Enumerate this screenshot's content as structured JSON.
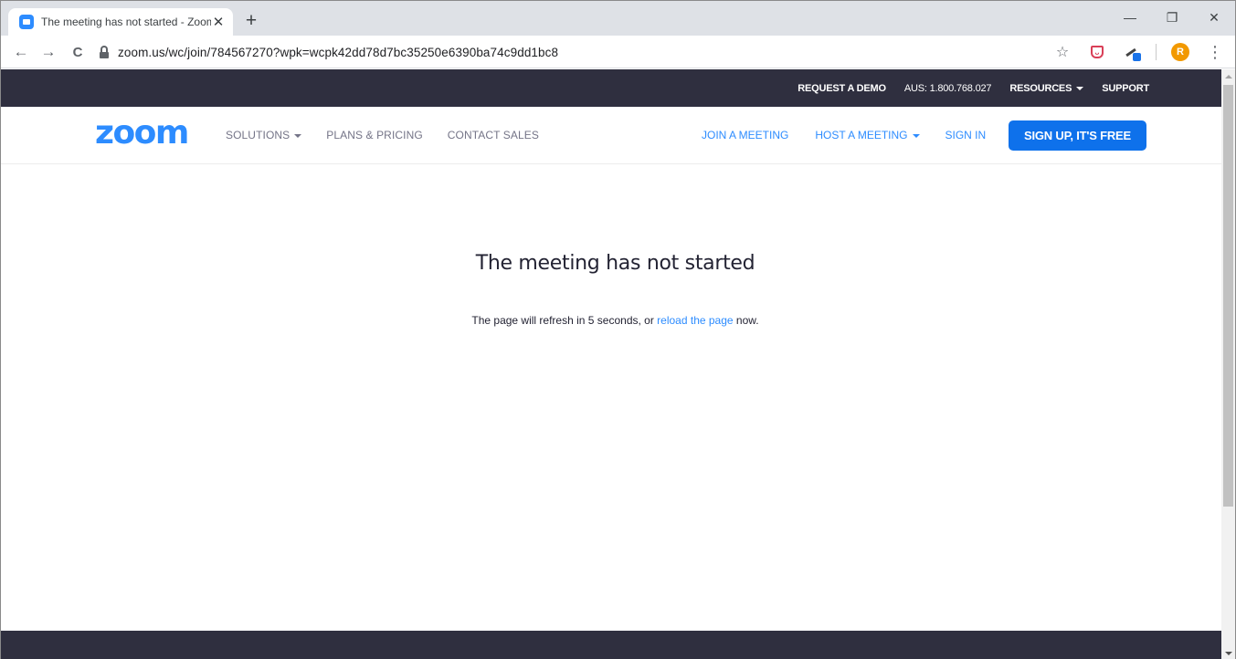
{
  "browser": {
    "tab_title": "The meeting has not started - Zoom",
    "new_tab_icon": "+",
    "tab_close_icon": "✕",
    "url": "zoom.us/wc/join/784567270?wpk=wcpk42dd78d7bc35250e6390ba74c9dd1bc8",
    "profile_initial": "R",
    "window_controls": {
      "minimize": "—",
      "restore": "❐",
      "close": "✕"
    },
    "nav": {
      "back": "←",
      "forward": "→",
      "reload": "C"
    },
    "bookmark_icon": "☆",
    "menu_icon": "⋮",
    "pocket_icon": "ᴗ"
  },
  "utility_bar": {
    "request_demo": "REQUEST A DEMO",
    "phone": "AUS: 1.800.768.027",
    "resources": "RESOURCES",
    "support": "SUPPORT"
  },
  "main_nav": {
    "logo": "zoom",
    "solutions": "SOLUTIONS",
    "plans_pricing": "PLANS & PRICING",
    "contact_sales": "CONTACT SALES",
    "join_meeting": "JOIN A MEETING",
    "host_meeting": "HOST A MEETING",
    "sign_in": "SIGN IN",
    "sign_up": "SIGN UP, IT'S FREE"
  },
  "message": {
    "headline": "The meeting has not started",
    "sub_prefix": "The page will refresh in 5 seconds, or ",
    "reload_link": "reload the page",
    "sub_suffix": " now."
  },
  "colors": {
    "brand_blue": "#2d8cff",
    "button_blue": "#0e71eb",
    "dark_bar": "#2f2f3f"
  }
}
